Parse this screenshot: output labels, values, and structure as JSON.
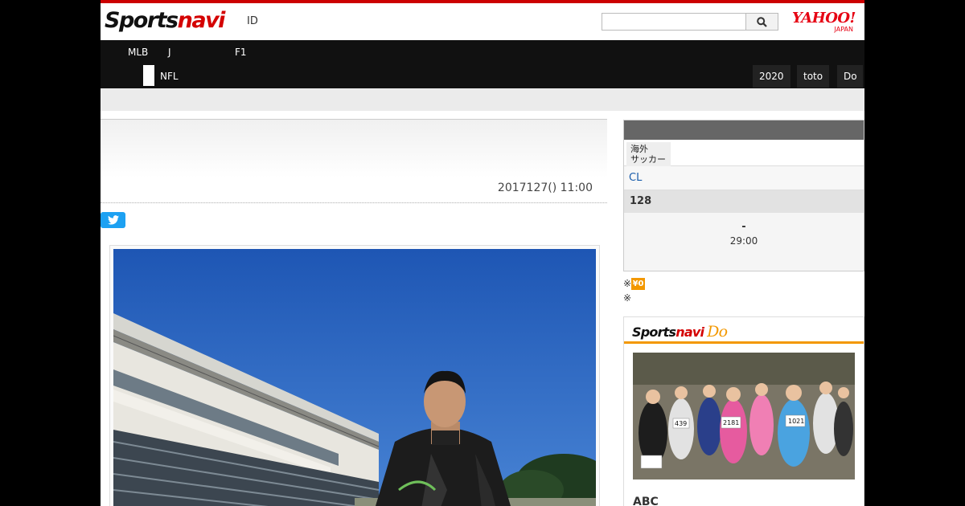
{
  "header": {
    "logo_part1": "Sports",
    "logo_part2": "navi",
    "id_link": "ID",
    "search_placeholder": "",
    "yahoo_logo": "YAHOO!",
    "yahoo_sub": "JAPAN"
  },
  "nav": {
    "row1": [
      "MLB",
      "J",
      "F1"
    ],
    "row2": [
      "NFL"
    ],
    "right_tabs": [
      "2020",
      "toto",
      "Do"
    ]
  },
  "article": {
    "date": "2017127() 11:00"
  },
  "sidebar": {
    "tab_overseas": "海外\nサッカー",
    "league": "CL",
    "date": "128",
    "match_score": "-",
    "match_time": "29:00",
    "note1_prefix": "※",
    "note1_badge": "¥0",
    "note2": "※"
  },
  "do_section": {
    "logo_part1": "Sports",
    "logo_part2": "navi",
    "logo_part3": "Do",
    "caption": "ABC",
    "bibs": [
      "1021",
      "2181",
      "439"
    ]
  },
  "colors": {
    "brand_red": "#d40000",
    "accent_orange": "#f39800",
    "nav_bg": "#111111",
    "twitter_blue": "#1da1f2"
  }
}
